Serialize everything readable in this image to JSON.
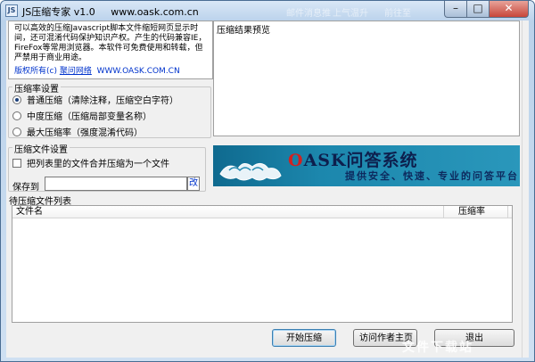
{
  "window": {
    "title": "JS压缩专家 v1.0",
    "title_url": "www.oask.com.cn",
    "bg_ghost": [
      "邮件消息推",
      "上气温升",
      "前往至"
    ],
    "controls": {
      "minimize": "–",
      "maximize": "□",
      "close": "✕"
    }
  },
  "info": {
    "description": "可以高效的压缩Javascript脚本文件缩短网页显示时间，还可混淆代码保护知识产权。产生的代码兼容IE，FireFox等常用浏览器。本软件可免费使用和转载，但严禁用于商业用途。",
    "copyright_prefix": "版权所有(c)",
    "copyright_link": "聚问网络",
    "copyright_url": "WWW.OASK.COM.CN"
  },
  "compression": {
    "legend": "压缩率设置",
    "options": [
      {
        "label": "普通压缩（清除注释，压缩空白字符）",
        "selected": true
      },
      {
        "label": "中度压缩（压缩局部变量名称）",
        "selected": false
      },
      {
        "label": "最大压缩率（强度混淆代码）",
        "selected": false
      }
    ]
  },
  "file_settings": {
    "legend": "压缩文件设置",
    "merge_label": "把列表里的文件合并压缩为一个文件",
    "merge_checked": false,
    "save_label": "保存到",
    "save_value": "",
    "change_label": "改"
  },
  "preview": {
    "label": "压缩结果预览"
  },
  "banner": {
    "title_o": "O",
    "title_rest": "ASK问答系统",
    "slogan": "提供安全、快速、专业的问答平台",
    "colors": {
      "bg": "#1c87ad",
      "title": "#0d1f4d",
      "accent": "#d32020"
    }
  },
  "file_list": {
    "label": "待压缩文件列表",
    "columns": [
      "文件名",
      "压缩率"
    ],
    "rows": []
  },
  "buttons": {
    "start": "开始压缩",
    "visit": "访问作者主页",
    "exit": "退出"
  },
  "watermark": "文件下载站"
}
